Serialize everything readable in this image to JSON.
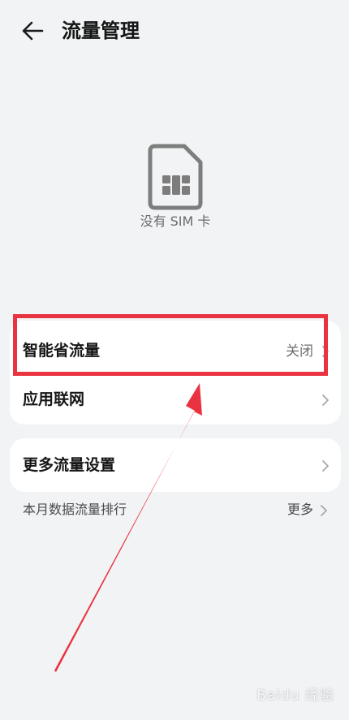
{
  "header": {
    "title": "流量管理"
  },
  "sim": {
    "label": "没有 SIM 卡",
    "icon": "sim-card-icon"
  },
  "card1": {
    "rows": [
      {
        "label": "智能省流量",
        "value": "关闭"
      },
      {
        "label": "应用联网",
        "value": ""
      }
    ]
  },
  "card2": {
    "rows": [
      {
        "label": "更多流量设置",
        "value": ""
      }
    ]
  },
  "footer": {
    "label": "本月数据流量排行",
    "more_label": "更多"
  },
  "annotation": {
    "highlight_color": "#ea3341"
  },
  "watermark": {
    "text": "Baidu 经验"
  }
}
